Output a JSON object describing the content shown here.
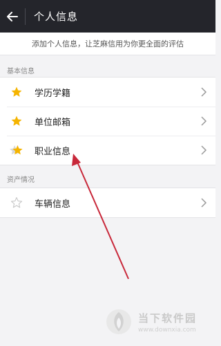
{
  "header": {
    "title": "个人信息"
  },
  "notice": {
    "text": "添加个人信息，让芝麻信用为你更全面的评估"
  },
  "sections": [
    {
      "label": "基本信息",
      "items": [
        {
          "label": "学历学籍",
          "icon": "star-filled-icon",
          "color": "#f5b400"
        },
        {
          "label": "单位邮箱",
          "icon": "star-filled-icon",
          "color": "#f5b400"
        },
        {
          "label": "职业信息",
          "icon": "star-half-icon",
          "color": "#f5b400"
        }
      ]
    },
    {
      "label": "资产情况",
      "items": [
        {
          "label": "车辆信息",
          "icon": "star-outline-icon",
          "color": "#c8c8c8"
        }
      ]
    }
  ],
  "watermark": {
    "title": "当下软件园",
    "url": "www.downxia.com"
  },
  "colors": {
    "topbar": "#24252b",
    "star": "#f5b400",
    "annotation_arrow": "#c8283a"
  }
}
